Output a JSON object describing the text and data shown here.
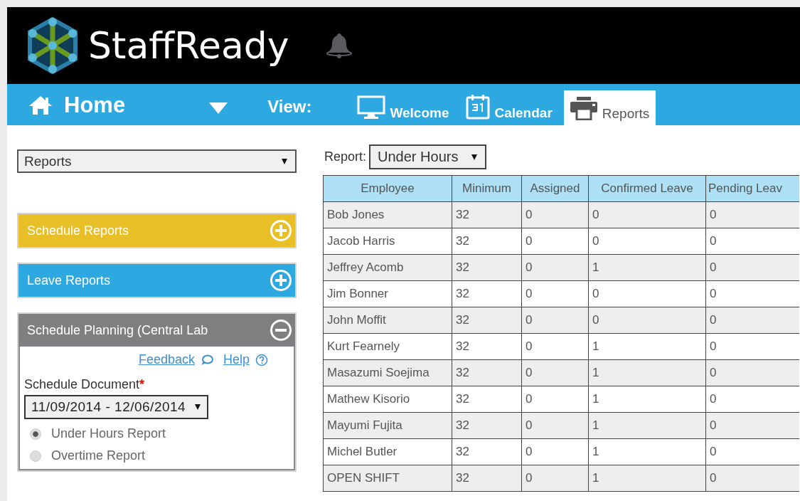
{
  "header": {
    "logo_text": "StaffReady"
  },
  "nav": {
    "home": "Home",
    "view_label": "View:",
    "tabs": [
      {
        "label": "Welcome",
        "kind": "monitor",
        "selected": false
      },
      {
        "label": "Calendar",
        "kind": "calendar",
        "selected": false
      },
      {
        "label": "Reports",
        "kind": "printer",
        "selected": true
      }
    ]
  },
  "sidebar": {
    "select": "Reports",
    "panels": [
      {
        "title": "Schedule Reports",
        "color": "#e8bf26",
        "expanded": false
      },
      {
        "title": "Leave Reports",
        "color": "#2ea8e0",
        "expanded": false
      },
      {
        "title": "Schedule Planning (Central Lab",
        "color": "#7f7f82",
        "expanded": true,
        "links": [
          {
            "label": "Feedback",
            "kind": "bubble"
          },
          {
            "label": "Help",
            "kind": "help"
          }
        ],
        "field_label": "Schedule Document",
        "required_mark": "*",
        "document": "11/09/2014 - 12/06/2014",
        "options": [
          {
            "label": "Under Hours Report",
            "selected": true
          },
          {
            "label": "Overtime Report",
            "selected": false
          }
        ]
      }
    ]
  },
  "report": {
    "label": "Report:",
    "select": "Under Hours",
    "table": {
      "columns": [
        "Employee",
        "Minimum",
        "Assigned",
        "Confirmed Leave",
        "Pending Leav"
      ],
      "rows": [
        [
          "Bob Jones",
          "32",
          "0",
          "0",
          "0"
        ],
        [
          "Jacob Harris",
          "32",
          "0",
          "0",
          "0"
        ],
        [
          "Jeffrey Acomb",
          "32",
          "0",
          "1",
          "0"
        ],
        [
          "Jim Bonner",
          "32",
          "0",
          "0",
          "0"
        ],
        [
          "John Moffit",
          "32",
          "0",
          "0",
          "0"
        ],
        [
          "Kurt Fearnely",
          "32",
          "0",
          "1",
          "0"
        ],
        [
          "Masazumi Soejima",
          "32",
          "0",
          "1",
          "0"
        ],
        [
          "Mathew Kisorio",
          "32",
          "0",
          "1",
          "0"
        ],
        [
          "Mayumi Fujita",
          "32",
          "0",
          "1",
          "0"
        ],
        [
          "Michel Butler",
          "32",
          "0",
          "1",
          "0"
        ],
        [
          "OPEN SHIFT",
          "32",
          "0",
          "1",
          "0"
        ]
      ]
    }
  }
}
